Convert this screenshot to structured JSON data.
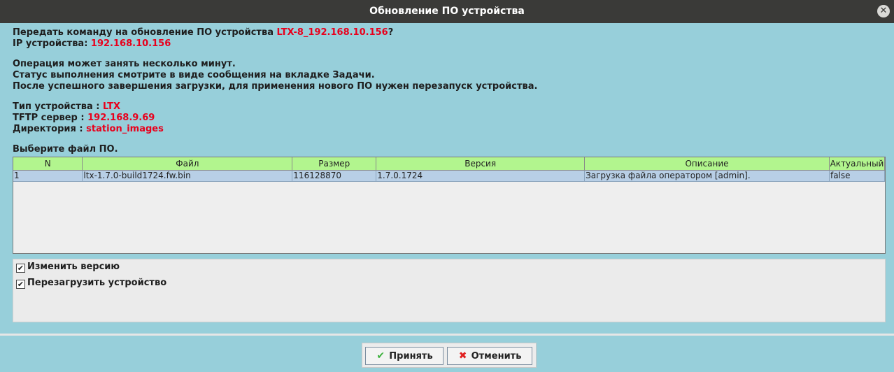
{
  "window": {
    "title": "Обновление ПО устройства"
  },
  "info": {
    "prompt_prefix": "Передать команду на обновление ПО устройства ",
    "device_name": "LTX-8_192.168.10.156",
    "prompt_suffix": "?",
    "ip_label": "IP устройства: ",
    "ip_value": "192.168.10.156",
    "note1": "Операция может занять несколько минут.",
    "note2": "Статус выполнения смотрите в виде сообщения на вкладке Задачи.",
    "note3": "После успешного завершения загрузки, для применения нового ПО нужен перезапуск устройства.",
    "type_label": "Тип устройства : ",
    "type_value": "LTX",
    "tftp_label": "TFTP сервер : ",
    "tftp_value": "192.168.9.69",
    "dir_label": "Директория : ",
    "dir_value": "station_images",
    "choose_label": "Выберите файл ПО."
  },
  "table": {
    "columns": [
      "N",
      "Файл",
      "Размер",
      "Версия",
      "Описание",
      "Актуальный"
    ],
    "rows": [
      [
        "1",
        "ltx-1.7.0-build1724.fw.bin",
        "116128870",
        "1.7.0.1724",
        "Загрузка файла оператором [admin].",
        "false"
      ]
    ]
  },
  "options": {
    "change_version": {
      "label": "Изменить версию",
      "checked": true
    },
    "reboot": {
      "label": "Перезагрузить устройство",
      "checked": true
    }
  },
  "buttons": {
    "accept": "Принять",
    "cancel": "Отменить"
  },
  "icons": {
    "close": "close-icon",
    "check": "check-icon",
    "cross": "cross-icon",
    "checkbox_mark": "✔"
  },
  "colors": {
    "accent_red": "#e8001c",
    "header_green": "#b2f58e",
    "row_selected": "#b8cfe6",
    "background": "#97cfda"
  }
}
